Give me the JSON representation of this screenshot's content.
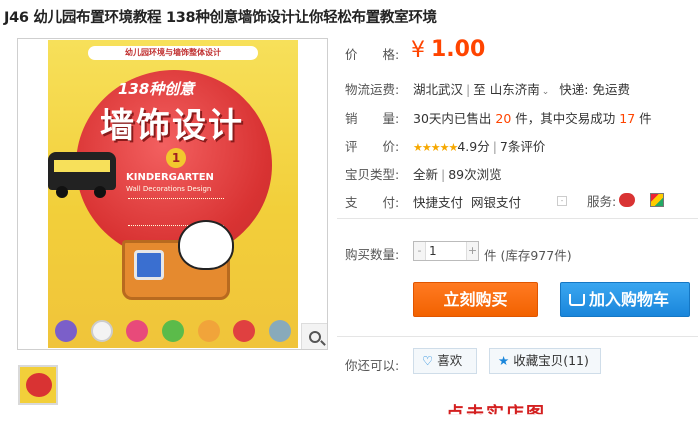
{
  "title": "J46 幼儿园布置环境教程 138种创意墙饰设计让你轻松布置教室环境",
  "image": {
    "cover_band": "幼儿园环境与墙饰整体设计",
    "cover_138": "138种创意",
    "cover_title": "墙饰设计",
    "cover_badge": "1",
    "cover_en1": "KINDERGARTEN",
    "cover_en2": "Wall Decorations Design"
  },
  "price": {
    "label": "价　　格:",
    "currency": "¥",
    "value": "1.00"
  },
  "shipping": {
    "label": "物流运费:",
    "from": "湖北武汉",
    "to": "山东济南",
    "delivery": "快递: 免运费"
  },
  "sales": {
    "label": "销　　量:",
    "prefix": "30天内已售出",
    "sold": "20",
    "mid": "件，其中交易成功",
    "success": "17",
    "suffix": "件"
  },
  "rating": {
    "label": "评　　价:",
    "stars": "★★★★★",
    "score": "4.9分",
    "reviews": "7条评价"
  },
  "item_type": {
    "label": "宝贝类型:",
    "condition": "全新",
    "views": "89次浏览"
  },
  "payment": {
    "label": "支　　付:",
    "method1": "快捷支付",
    "method2": "网银支付",
    "service_label": "服务:"
  },
  "quantity": {
    "label": "购买数量:",
    "value": "1",
    "minus": "-",
    "plus": "+",
    "stock": "件 (库存977件)"
  },
  "buttons": {
    "buy": "立刻购买",
    "cart": "加入购物车"
  },
  "also": {
    "label": "你还可以:",
    "like": "喜欢",
    "collect": "收藏宝贝(11)"
  },
  "footer_partial": "点击实店图"
}
